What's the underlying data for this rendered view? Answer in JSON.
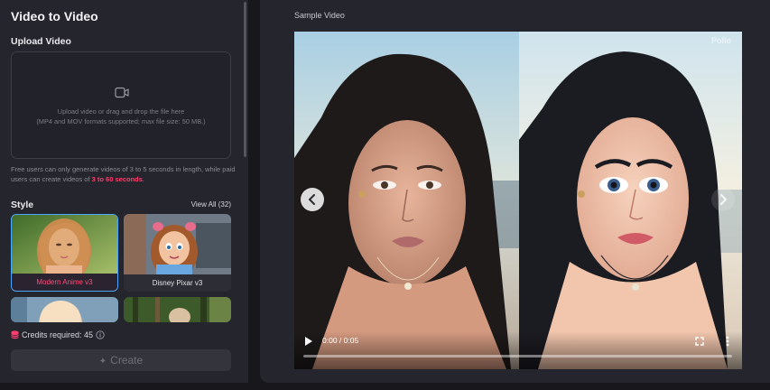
{
  "left": {
    "title": "Video to Video",
    "upload_label": "Upload Video",
    "dropzone": {
      "icon": "video-camera-icon",
      "line1": "Upload video or drag and drop the file here",
      "line2": "(MP4 and MOV formats supported; max file size: 50 MB.)"
    },
    "notice": {
      "part1": "Free users can only generate videos of 3 to 5 seconds in length, while paid users can create videos of ",
      "highlight": "3 to 60 seconds",
      "part2": "."
    },
    "style": {
      "label": "Style",
      "view_all": "View All (32)",
      "cards": [
        {
          "label": "Modern Anime v3",
          "selected": true
        },
        {
          "label": "Disney Pixar v3",
          "selected": false
        },
        {
          "label": "",
          "selected": false
        },
        {
          "label": "",
          "selected": false
        }
      ]
    },
    "credits": {
      "label": "Credits required: 45",
      "icon": "database-icon",
      "info_icon": "info-icon"
    },
    "create_button": {
      "label": "Create",
      "icon": "sparkle-icon"
    }
  },
  "right": {
    "sample_label": "Sample Video",
    "video": {
      "watermark": "Pollo",
      "time": "0:00 / 0:05",
      "progress": 0.0,
      "icons": [
        "play-icon",
        "fullscreen-icon",
        "more-vertical-icon",
        "chevron-left-icon",
        "chevron-right-icon"
      ]
    }
  },
  "colors": {
    "accent_pink": "#ff3d6e",
    "panel_bg": "#25252d",
    "page_bg": "#17171c",
    "selected_border": "#4aa7ff"
  }
}
